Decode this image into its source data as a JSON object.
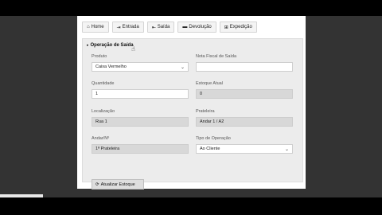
{
  "tabs": [
    {
      "icon": "home-icon",
      "glyph": "⌂",
      "label": "Home"
    },
    {
      "icon": "sign-in-icon",
      "glyph": "⇥",
      "label": "Entrada"
    },
    {
      "icon": "sign-out-icon",
      "glyph": "⇤",
      "label": "Saída"
    },
    {
      "icon": "truck-icon",
      "glyph": "▬",
      "label": "Devolução"
    },
    {
      "icon": "sitemap-icon",
      "glyph": "⊞",
      "label": "Expedição"
    }
  ],
  "form": {
    "title": "Operação de Saída",
    "produto": {
      "label": "Produto",
      "value": "Caixa Vermelho"
    },
    "nota_fiscal": {
      "label": "Nota Fiscal de Saída",
      "value": ""
    },
    "quantidade": {
      "label": "Quantidade",
      "value": "1"
    },
    "estoque_atual": {
      "label": "Estoque Atual",
      "value": "0"
    },
    "localizacao": {
      "label": "Localização",
      "value": "Rua 1"
    },
    "prateleira": {
      "label": "Prateleira",
      "value": "Andar 1 / A2"
    },
    "andar": {
      "label": "Andar/Nº",
      "value": "1ª Prateleira"
    },
    "tipo_operacao": {
      "label": "Tipo de Operação",
      "value": "Ao Cliente"
    },
    "submit_label": "Atualizar Estoque"
  }
}
